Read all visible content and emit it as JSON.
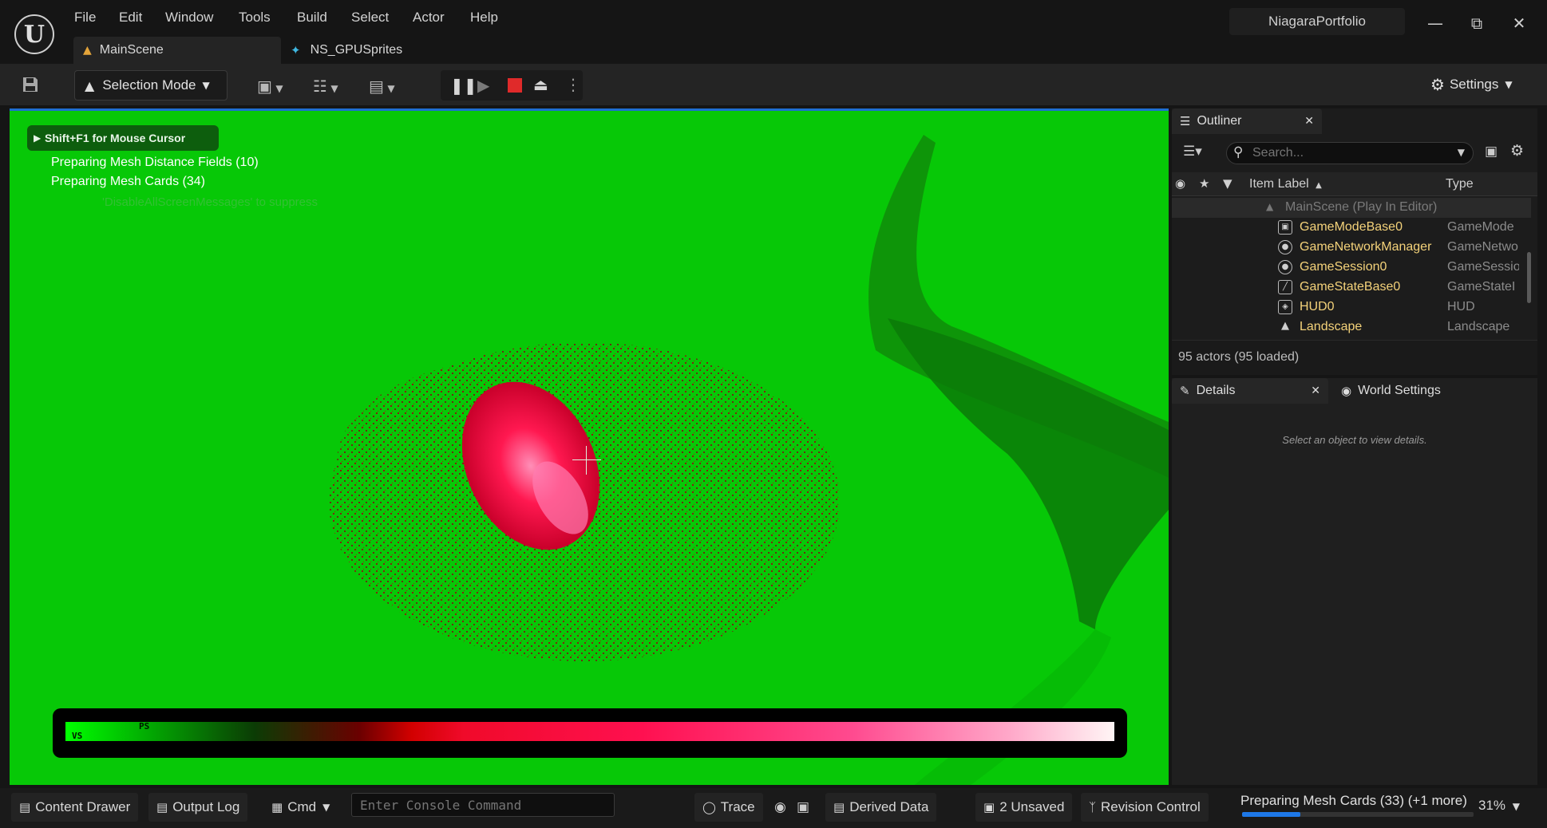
{
  "menu": [
    "File",
    "Edit",
    "Window",
    "Tools",
    "Build",
    "Select",
    "Actor",
    "Help"
  ],
  "project_name": "NiagaraPortfolio",
  "tabs": [
    {
      "label": "MainScene",
      "icon": "level-icon"
    },
    {
      "label": "NS_GPUSprites",
      "icon": "niagara-system-icon"
    }
  ],
  "toolbar": {
    "selection_mode": "Selection Mode",
    "settings": "Settings"
  },
  "viewport": {
    "hint": "Shift+F1 for Mouse Cursor",
    "messages": [
      "Preparing Mesh Distance Fields (10)",
      "Preparing Mesh Cards (34)",
      "'DisableAllScreenMessages' to suppress"
    ],
    "gradient_tags": [
      "PS",
      "VS"
    ],
    "background_color": "#07C807"
  },
  "outliner": {
    "title": "Outliner",
    "search_placeholder": "Search...",
    "col_label": "Item Label",
    "col_type": "Type",
    "root": "MainScene (Play In Editor)",
    "rows": [
      {
        "label": "GameModeBase0",
        "type": "GameMode",
        "icon": "game-mode-icon"
      },
      {
        "label": "GameNetworkManager",
        "type": "GameNetwo",
        "icon": "actor-icon"
      },
      {
        "label": "GameSession0",
        "type": "GameSessio",
        "icon": "actor-icon"
      },
      {
        "label": "GameStateBase0",
        "type": "GameStateI",
        "icon": "game-state-icon"
      },
      {
        "label": "HUD0",
        "type": "HUD",
        "icon": "hud-icon"
      },
      {
        "label": "Landscape",
        "type": "Landscape",
        "icon": "landscape-icon"
      }
    ],
    "status": "95 actors (95 loaded)"
  },
  "details": {
    "tab_details": "Details",
    "tab_world": "World Settings",
    "empty_message": "Select an object to view details."
  },
  "statusbar": {
    "content_drawer": "Content Drawer",
    "output_log": "Output Log",
    "cmd": "Cmd",
    "console_placeholder": "Enter Console Command",
    "trace": "Trace",
    "derived_data": "Derived Data",
    "unsaved": "2 Unsaved",
    "revision_control": "Revision Control",
    "progress_label": "Preparing Mesh Cards (33) (+1 more)",
    "progress_fraction": 0.25,
    "progress_percent": "31%"
  },
  "accent_color": "#1E78E8"
}
